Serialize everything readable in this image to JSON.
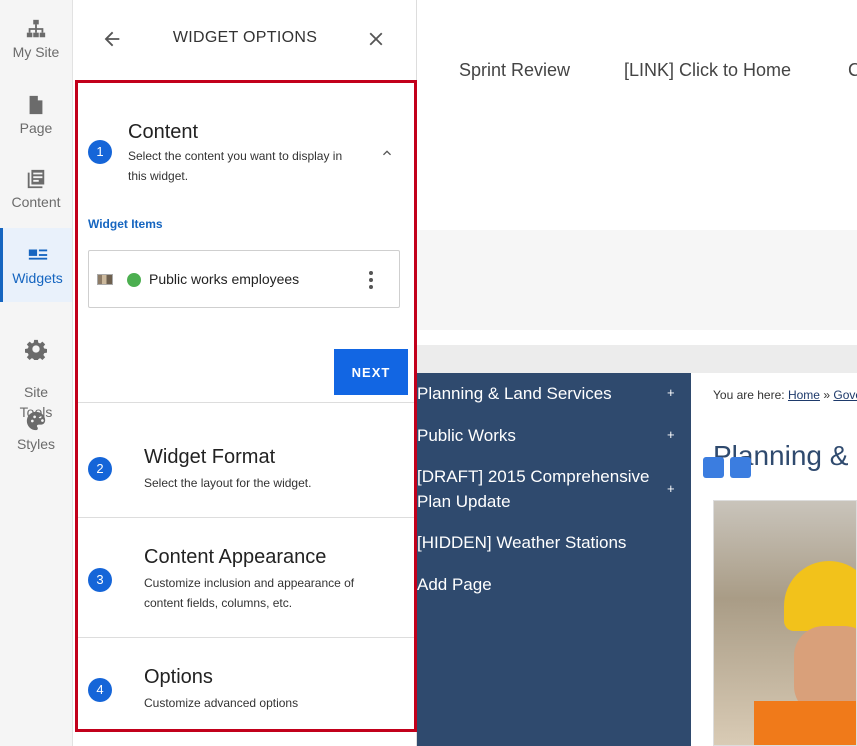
{
  "rail": {
    "items": [
      {
        "label": "My Site",
        "icon": "sitemap-icon"
      },
      {
        "label": "Page",
        "icon": "page-icon"
      },
      {
        "label": "Content",
        "icon": "content-icon"
      },
      {
        "label": "Widgets",
        "icon": "widgets-icon",
        "active": true
      },
      {
        "label": "Site\nTools",
        "icon": "gear-icon"
      },
      {
        "label": "Styles",
        "icon": "palette-icon"
      }
    ],
    "active_color": "#1565c0"
  },
  "panel": {
    "title": "WIDGET OPTIONS",
    "steps": [
      {
        "number": "1",
        "title": "Content",
        "description": "Select the content you want to display in this widget.",
        "expanded": true
      },
      {
        "number": "2",
        "title": "Widget Format",
        "description": "Select the layout for the widget."
      },
      {
        "number": "3",
        "title": "Content Appearance",
        "description": "Customize inclusion and appearance of content fields, columns, etc."
      },
      {
        "number": "4",
        "title": "Options",
        "description": "Customize advanced options"
      }
    ],
    "widget_items_label": "Widget Items",
    "widget_items": [
      {
        "name": "Public works employees",
        "status_color": "#4caf50"
      }
    ],
    "next_label": "NEXT",
    "highlight_color": "#c2001b"
  },
  "site": {
    "topnav": [
      "Sprint Review",
      "[LINK] Click to Home",
      "C"
    ],
    "sidenav": [
      {
        "label": "Planning & Land Services",
        "has_children": true
      },
      {
        "label": "Public Works",
        "has_children": true
      },
      {
        "label": "[DRAFT] 2015 Comprehensive Plan Update",
        "has_children": true
      },
      {
        "label": "[HIDDEN] Weather Stations",
        "has_children": false
      },
      {
        "label": "Add Page",
        "has_children": false
      }
    ],
    "plus": "+",
    "breadcrumb": {
      "prefix": "You are here:",
      "home": "Home",
      "sep": "»",
      "next": "Gove"
    },
    "page_heading": "Planning &"
  }
}
